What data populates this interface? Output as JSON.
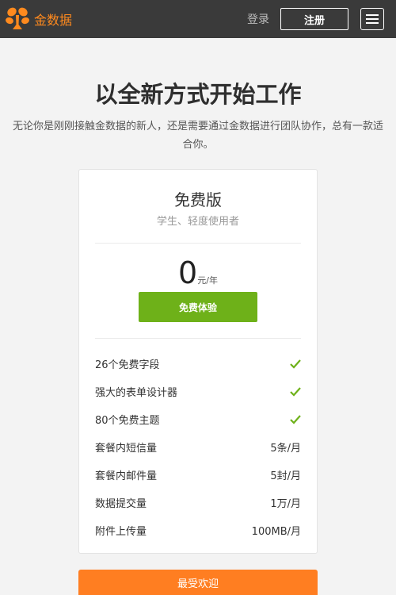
{
  "brand": {
    "name": "金数据",
    "color": "#ff8a1e"
  },
  "nav": {
    "login": "登录",
    "register": "注册"
  },
  "hero": {
    "title": "以全新方式开始工作",
    "description": "无论你是刚刚接触金数据的新人，还是需要通过金数据进行团队协作，总有一款适合你。"
  },
  "plan": {
    "name": "免费版",
    "subtitle": "学生、轻度使用者",
    "price": "0",
    "unit": "元/年",
    "cta": "免费体验",
    "cta_color": "#6eb119",
    "features": [
      {
        "label": "26个免费字段",
        "icon": "check-icon"
      },
      {
        "label": "强大的表单设计器",
        "icon": "check-icon"
      },
      {
        "label": "80个免费主题",
        "icon": "check-icon"
      },
      {
        "label": "套餐内短信量",
        "value": "5条/月"
      },
      {
        "label": "套餐内邮件量",
        "value": "5封/月"
      },
      {
        "label": "数据提交量",
        "value": "1万/月"
      },
      {
        "label": "附件上传量",
        "value": "100MB/月"
      }
    ]
  },
  "popular": {
    "label": "最受欢迎",
    "color": "#ff7e21"
  }
}
